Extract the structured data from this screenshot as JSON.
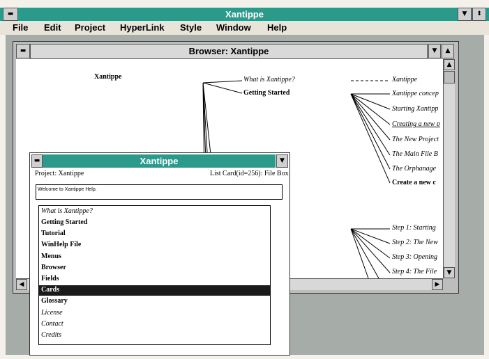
{
  "app": {
    "title": "Xantippe",
    "menu": [
      "File",
      "Edit",
      "Project",
      "HyperLink",
      "Style",
      "Window",
      "Help"
    ]
  },
  "browser": {
    "title": "Browser: Xantippe",
    "root": "Xantippe",
    "level1": [
      "What is Xantippe?",
      "Getting Started"
    ],
    "right_top": [
      "Xantippe",
      "Xantippe concep",
      "Starting Xantipp",
      "Creating a new p",
      "The New Project",
      "The Main File B",
      "The Orphanage",
      "Create a new c"
    ],
    "right_bottom": [
      "Step 1: Starting",
      "Step 2: The New",
      "Step 3: Opening",
      "Step 4: The File"
    ]
  },
  "dialog": {
    "title": "Xantippe",
    "project_label": "Project: Xantippe",
    "card_label": "List Card(id=256): File Box",
    "field_value": "Welcome to Xantippe Help.",
    "list_items": [
      "What is Xantippe?",
      "Getting Started",
      "Tutorial",
      "WinHelp File",
      "Menus",
      "Browser",
      "Fields",
      "Cards",
      "Glossary",
      "License",
      "Contact",
      "Credits"
    ],
    "selected_index": 7
  },
  "colors": {
    "titlebar": "#2c9a8a",
    "selection": "#1a1a1a"
  }
}
